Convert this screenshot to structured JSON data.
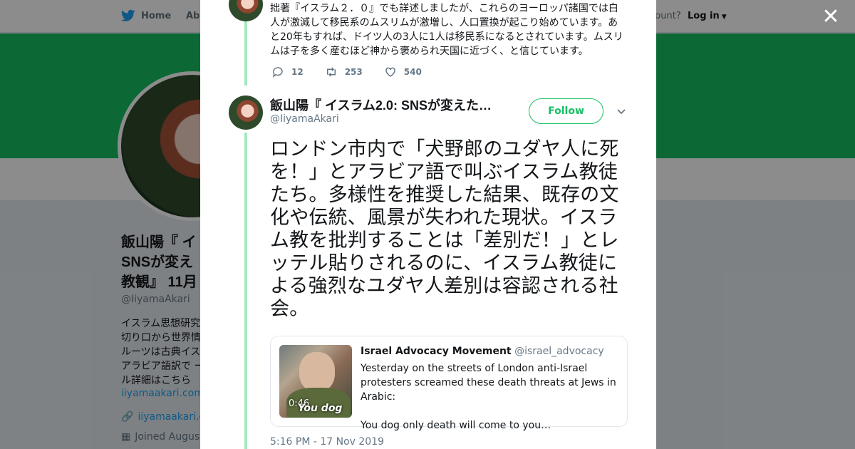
{
  "nav": {
    "home": "Home",
    "about": "Abo",
    "account_prompt": "ccount?",
    "login": "Log in"
  },
  "profile": {
    "name": "飯山陽『 イ SNSが変え 教観』 11月",
    "handle": "@IiyamaAkari",
    "bio": "イスラム思想研究 切り口から世界情 ルーツは古典イス アラビア語訳で ール詳細はこちら",
    "link": "iiyamaakari.com/2",
    "url": "iiyamaakari.co",
    "joined": "Joined August"
  },
  "previous_tweet": {
    "text": "拙著『イスラム２．０』でも詳述しましたが、これらのヨーロッパ諸国では白人が激減して移民系のムスリムが激増し、人口置換が起こり始めています。あと20年もすれば、ドイツ人の3人に1人は移民系になるとされています。ムスリムは子を多く産むほど神から褒められ天国に近づく、と信じています。",
    "replies": "12",
    "retweets": "253",
    "likes": "540"
  },
  "tweet": {
    "name": "飯山陽『 イスラム2.0: SNSが変えた…",
    "handle": "@IiyamaAkari",
    "follow_label": "Follow",
    "text": "ロンドン市内で「犬野郎のユダヤ人に死を！」とアラビア語で叫ぶイスラム教徒たち。多様性を推奨した結果、既存の文化や伝統、風景が失われた現状。イスラム教を批判することは「差別だ！」とレッテル貼りされるのに、イスラム教徒による強烈なユダヤ人差別は容認される社会。",
    "timestamp": "5:16 PM - 17 Nov 2019"
  },
  "quote": {
    "name": "Israel Advocacy Movement",
    "handle": "@israel_advocacy",
    "body": "Yesterday on the streets of London anti-Israel protesters screamed these death threats at Jews in Arabic:\n\nYou dog only death will come to you…",
    "duration": "0:46",
    "subtitle": "You dog"
  },
  "colors": {
    "accent": "#17bf63",
    "thread": "#a3e9c2",
    "twitter_blue": "#1da1f2"
  }
}
